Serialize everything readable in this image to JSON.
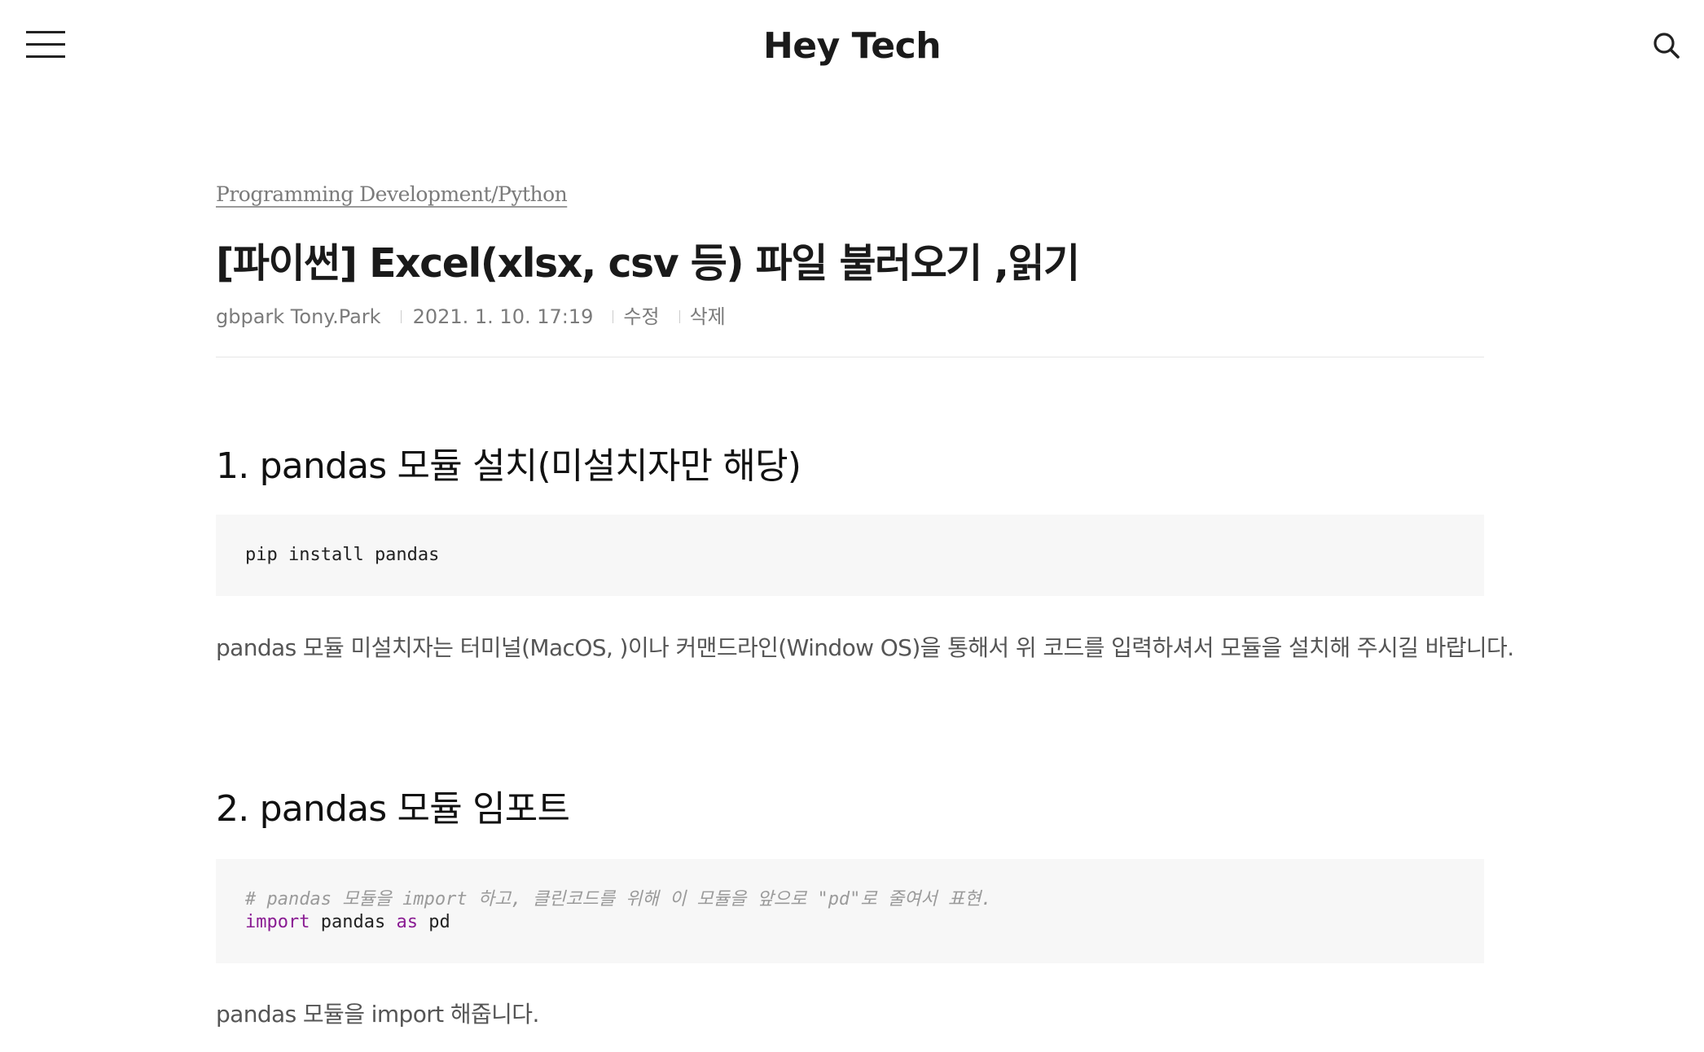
{
  "header": {
    "blog_title": "Hey Tech",
    "menu_icon": "hamburger-menu-icon",
    "search_icon": "search-icon"
  },
  "post": {
    "category": "Programming Development/Python",
    "title": "[파이썬] Excel(xlsx, csv 등) 파일 불러오기 ,읽기",
    "meta": {
      "author": "gbpark Tony.Park",
      "datetime": "2021. 1. 10. 17:19",
      "edit_label": "수정",
      "delete_label": "삭제"
    }
  },
  "sections": [
    {
      "heading": "1. pandas 모듈 설치(미설치자만 해당)",
      "code": {
        "line1": "pip install pandas"
      },
      "paragraph": "pandas 모듈 미설치자는 터미널(MacOS, )이나 커맨드라인(Window OS)을 통해서 위 코드를 입력하셔서 모듈을 설치해 주시길 바랍니다."
    },
    {
      "heading": "2. pandas 모듈 임포트",
      "code": {
        "comment": "# pandas 모듈을 import 하고, 클린코드를 위해 이 모듈을 앞으로 \"pd\"로 줄여서 표현.",
        "kw_import": "import",
        "module": "pandas",
        "kw_as": "as",
        "alias": "pd"
      },
      "paragraph": "pandas 모듈을 import 해줍니다."
    }
  ],
  "colors": {
    "code_background": "#f7f7f7",
    "keyword": "#8a1c93",
    "comment": "#9a9a9a",
    "meta_text": "#7b7b7b"
  }
}
